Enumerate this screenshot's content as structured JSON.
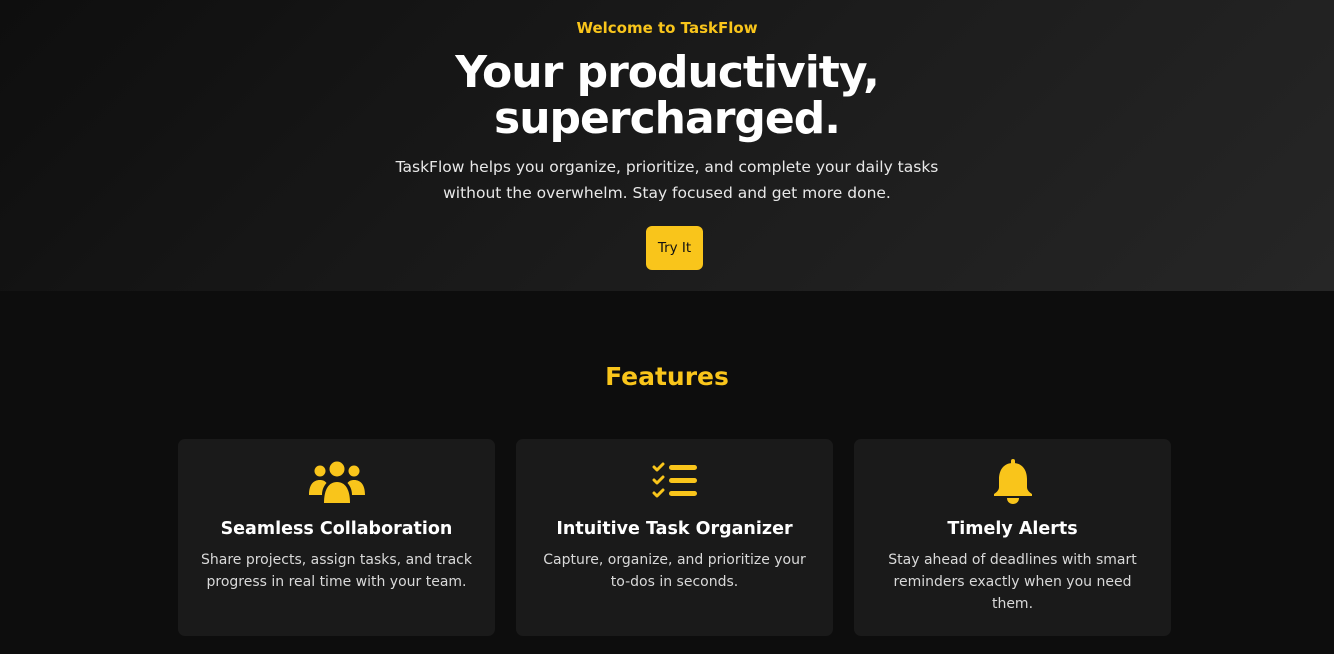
{
  "hero": {
    "eyebrow": "Welcome to TaskFlow",
    "headline_line1": "Your productivity,",
    "headline_line2": "supercharged.",
    "subtext": "TaskFlow helps you organize, prioritize, and complete your daily tasks without the overwhelm. Stay focused and get more done.",
    "cta_label": "Try It"
  },
  "features": {
    "title": "Features",
    "cards": [
      {
        "icon": "users-group-icon",
        "title": "Seamless Collaboration",
        "text": "Share projects, assign tasks, and track progress in real time with your team."
      },
      {
        "icon": "checklist-icon",
        "title": "Intuitive Task Organizer",
        "text": "Capture, organize, and prioritize your to-dos in seconds."
      },
      {
        "icon": "bell-icon",
        "title": "Timely Alerts",
        "text": "Stay ahead of deadlines with smart reminders exactly when you need them."
      }
    ]
  },
  "colors": {
    "accent": "#f9c51b",
    "background": "#0d0d0d",
    "card": "#1a1a1a"
  }
}
